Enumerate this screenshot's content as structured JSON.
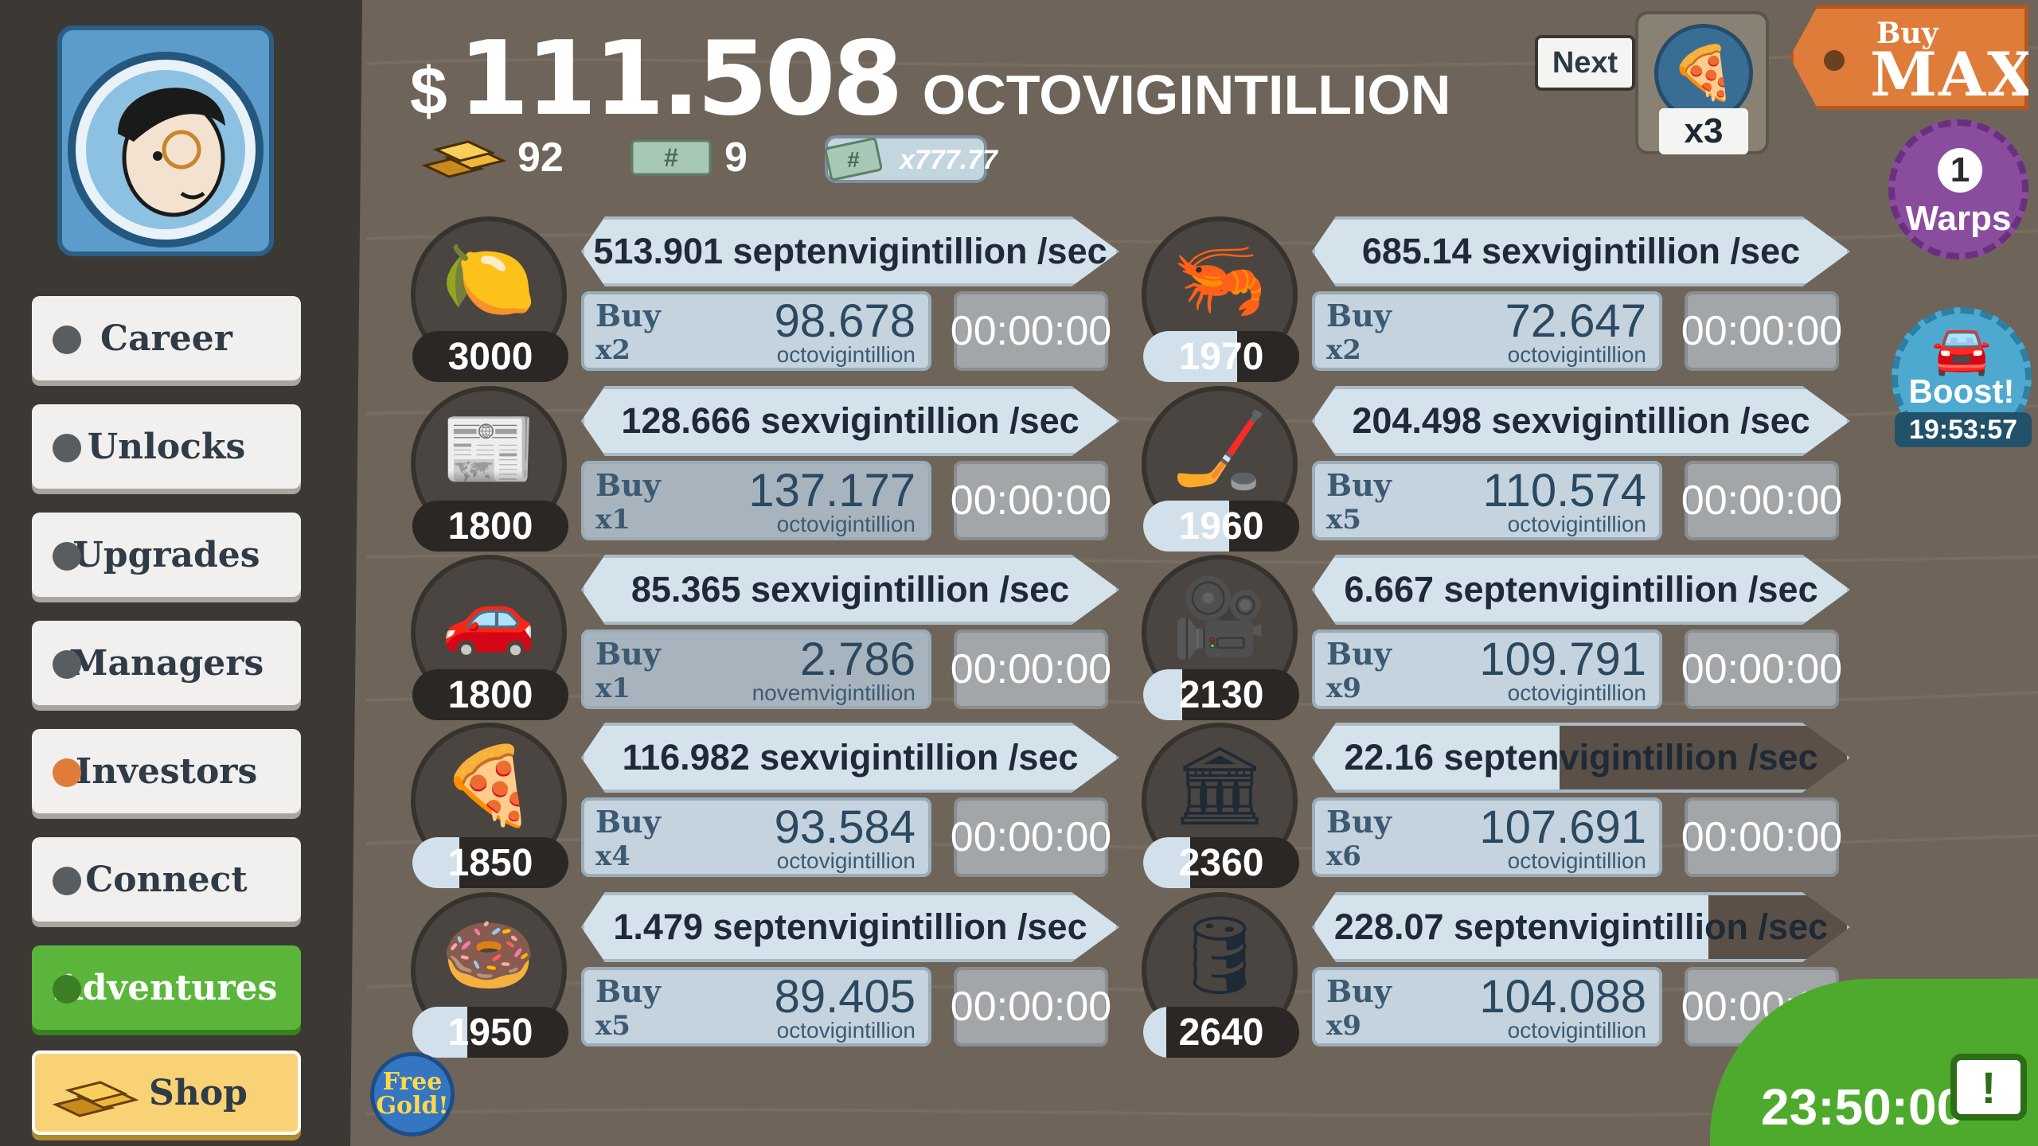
{
  "money": {
    "symbol": "$",
    "amount": "111.508",
    "unit": "OCTOVIGINTILLION"
  },
  "stats": {
    "gold": "92",
    "megabucks": "9",
    "multiplier": "x777.77"
  },
  "sidebar": {
    "items": [
      {
        "label": "Career"
      },
      {
        "label": "Unlocks"
      },
      {
        "label": "Upgrades"
      },
      {
        "label": "Managers"
      },
      {
        "label": "Investors"
      },
      {
        "label": "Connect"
      },
      {
        "label": "Adventures"
      },
      {
        "label": "Shop"
      }
    ]
  },
  "next": {
    "label": "Next",
    "multiplier": "x3",
    "icon": "pizza-icon"
  },
  "buymax": {
    "line1": "Buy",
    "line2": "MAX"
  },
  "warps": {
    "count": "1",
    "label": "Warps"
  },
  "boost": {
    "label": "Boost!",
    "timer": "19:53:57"
  },
  "tv": {
    "timer": "23:50:00",
    "icon": "!"
  },
  "freegold": {
    "line1": "Free",
    "line2": "Gold!"
  },
  "businesses": [
    {
      "icon": "lemon-icon",
      "count": "3000",
      "count_fill": 0.0,
      "rate": "513.901 septenvigintillion /sec",
      "rate_progress": 1.0,
      "buy_label": "Buy",
      "buy_mult": "x2",
      "price": "98.678",
      "price_unit": "octovigintillion",
      "timer": "00:00:00",
      "affordable": true
    },
    {
      "icon": "newspaper-icon",
      "count": "1800",
      "count_fill": 0.0,
      "rate": "128.666 sexvigintillion /sec",
      "rate_progress": 1.0,
      "buy_label": "Buy",
      "buy_mult": "x1",
      "price": "137.177",
      "price_unit": "octovigintillion",
      "timer": "00:00:00",
      "affordable": false
    },
    {
      "icon": "car-wash-icon",
      "count": "1800",
      "count_fill": 0.0,
      "rate": "85.365 sexvigintillion /sec",
      "rate_progress": 1.0,
      "buy_label": "Buy",
      "buy_mult": "x1",
      "price": "2.786",
      "price_unit": "novemvigintillion",
      "timer": "00:00:00",
      "affordable": false
    },
    {
      "icon": "pizza-icon",
      "count": "1850",
      "count_fill": 0.3,
      "rate": "116.982 sexvigintillion /sec",
      "rate_progress": 1.0,
      "buy_label": "Buy",
      "buy_mult": "x4",
      "price": "93.584",
      "price_unit": "octovigintillion",
      "timer": "00:00:00",
      "affordable": true
    },
    {
      "icon": "donut-icon",
      "count": "1950",
      "count_fill": 0.35,
      "rate": "1.479 septenvigintillion /sec",
      "rate_progress": 1.0,
      "buy_label": "Buy",
      "buy_mult": "x5",
      "price": "89.405",
      "price_unit": "octovigintillion",
      "timer": "00:00:00",
      "affordable": true
    },
    {
      "icon": "shrimp-icon",
      "count": "1970",
      "count_fill": 0.6,
      "rate": "685.14 sexvigintillion /sec",
      "rate_progress": 1.0,
      "buy_label": "Buy",
      "buy_mult": "x2",
      "price": "72.647",
      "price_unit": "octovigintillion",
      "timer": "00:00:00",
      "affordable": true
    },
    {
      "icon": "hockey-icon",
      "count": "1960",
      "count_fill": 0.55,
      "rate": "204.498 sexvigintillion /sec",
      "rate_progress": 1.0,
      "buy_label": "Buy",
      "buy_mult": "x5",
      "price": "110.574",
      "price_unit": "octovigintillion",
      "timer": "00:00:00",
      "affordable": true
    },
    {
      "icon": "movie-camera-icon",
      "count": "2130",
      "count_fill": 0.25,
      "rate": "6.667 septenvigintillion /sec",
      "rate_progress": 1.0,
      "buy_label": "Buy",
      "buy_mult": "x9",
      "price": "109.791",
      "price_unit": "octovigintillion",
      "timer": "00:00:00",
      "affordable": true
    },
    {
      "icon": "bank-icon",
      "count": "2360",
      "count_fill": 0.3,
      "rate": "22.16 septenvigintillion /sec",
      "rate_progress": 0.46,
      "buy_label": "Buy",
      "buy_mult": "x6",
      "price": "107.691",
      "price_unit": "octovigintillion",
      "timer": "00:00:00",
      "affordable": true
    },
    {
      "icon": "oil-rig-icon",
      "count": "2640",
      "count_fill": 0.15,
      "rate": "228.07 septenvigintillion /sec",
      "rate_progress": 0.74,
      "buy_label": "Buy",
      "buy_mult": "x9",
      "price": "104.088",
      "price_unit": "octovigintillion",
      "timer": "00:00:00",
      "affordable": true
    }
  ]
}
